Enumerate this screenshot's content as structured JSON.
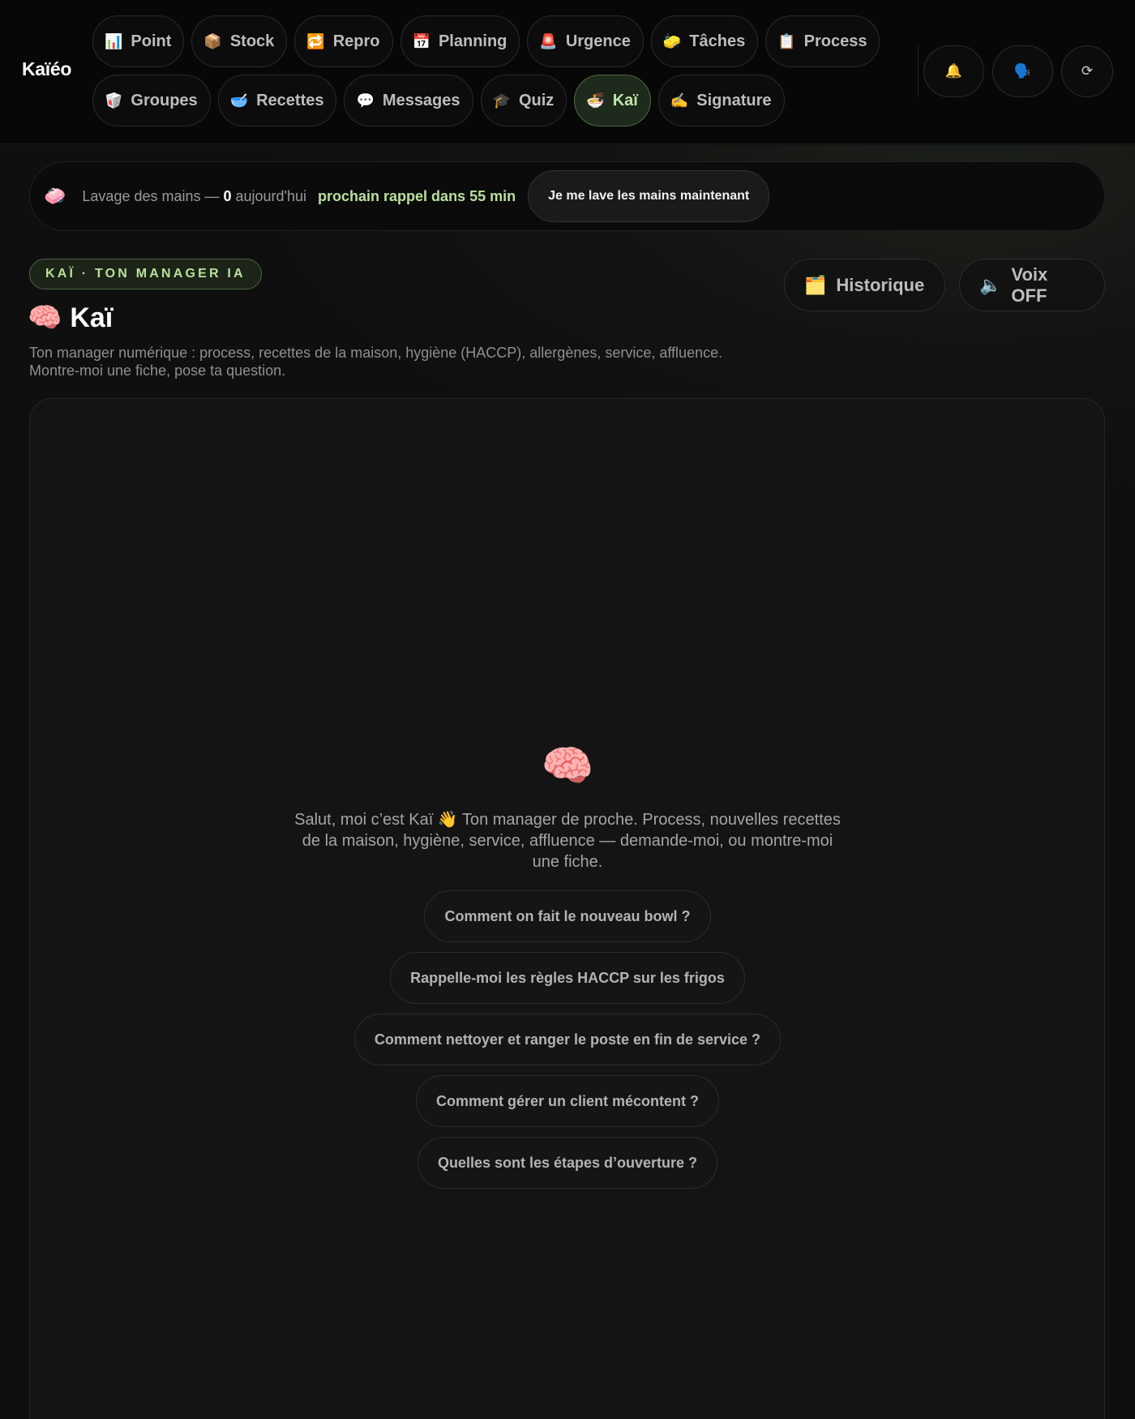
{
  "brand": "Kaïéo",
  "nav": {
    "row1": [
      {
        "icon": "📊",
        "label": "Point"
      },
      {
        "icon": "📦",
        "label": "Stock"
      },
      {
        "icon": "🔁",
        "label": "Repro"
      },
      {
        "icon": "📅",
        "label": "Planning"
      },
      {
        "icon": "🚨",
        "label": "Urgence"
      },
      {
        "icon": "🧽",
        "label": "Tâches"
      },
      {
        "icon": "📋",
        "label": "Process"
      }
    ],
    "row2": [
      {
        "icon": "🥡",
        "label": "Groupes"
      },
      {
        "icon": "🥣",
        "label": "Recettes"
      },
      {
        "icon": "💬",
        "label": "Messages"
      },
      {
        "icon": "🎓",
        "label": "Quiz"
      },
      {
        "icon": "🍜",
        "label": "Kaï",
        "active": true
      },
      {
        "icon": "✍️",
        "label": "Signature"
      }
    ]
  },
  "header_icons": {
    "bell": "🔔",
    "voice": "🗣️",
    "refresh": "⟳"
  },
  "hand_wash": {
    "icon": "🧼",
    "prefix": "Lavage des mains — ",
    "count": "0",
    "suffix": " aujourd'hui",
    "next_reminder": "prochain rappel dans 55 min",
    "button": "Je me lave les mains maintenant"
  },
  "page": {
    "badge": "KAÏ · TON MANAGER IA",
    "title_icon": "🧠",
    "title": "Kaï",
    "subtitle": "Ton manager numérique : process, recettes de la maison, hygiène (HACCP), allergènes, service, affluence. Montre-moi une fiche, pose ta question.",
    "history_icon": "🗂️",
    "history_label": "Historique",
    "voice_icon": "🔈",
    "voice_label": "Voix OFF"
  },
  "chat": {
    "brain_icon": "🧠",
    "welcome": "Salut, moi c’est Kaï 👋 Ton manager de proche. Process, nouvelles recettes de la maison, hygiène, service, affluence — demande-moi, ou montre-moi une fiche.",
    "suggestions": [
      "Comment on fait le nouveau bowl ?",
      "Rappelle-moi les règles HACCP sur les frigos",
      "Comment nettoyer et ranger le poste en fin de service ?",
      "Comment gérer un client mécontent ?",
      "Quelles sont les étapes d’ouverture ?"
    ]
  }
}
